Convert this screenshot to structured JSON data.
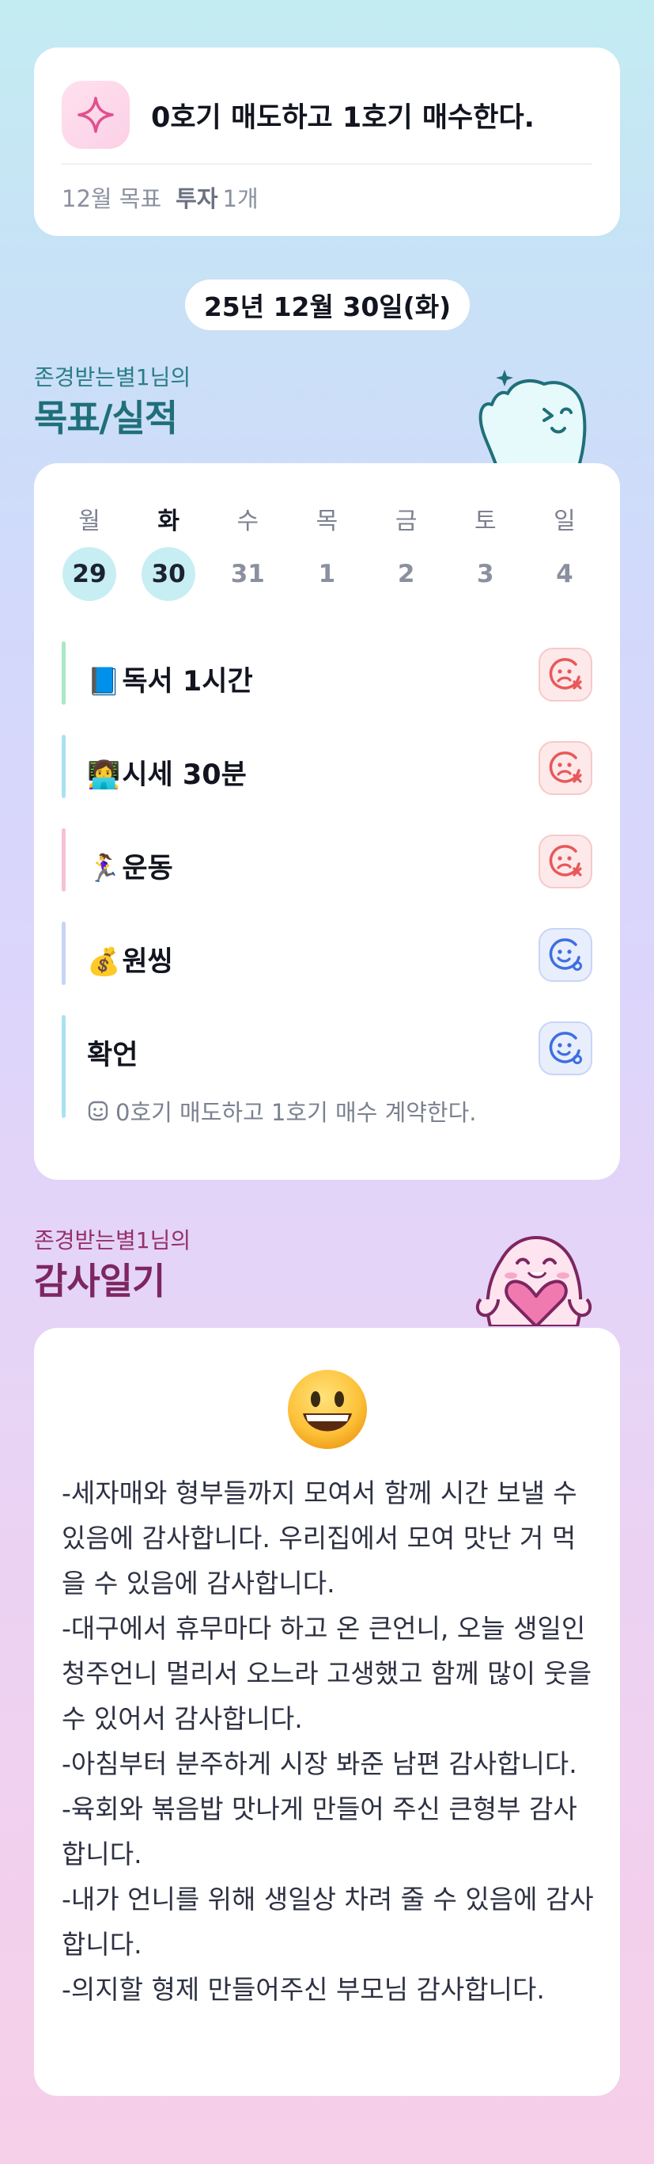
{
  "goal": {
    "title": "0호기 매도하고 1호기 매수한다.",
    "period": "12월 목표",
    "category": "투자",
    "count": "1개",
    "icon": "sparkle-icon"
  },
  "date_label": "25년 12월 30일(화)",
  "section_goals": {
    "subtitle": "존경받는별1님의",
    "title": "목표/실적"
  },
  "week": [
    {
      "dow": "월",
      "num": "29",
      "marked": true,
      "selected": false
    },
    {
      "dow": "화",
      "num": "30",
      "marked": true,
      "selected": true
    },
    {
      "dow": "수",
      "num": "31",
      "marked": false,
      "selected": false
    },
    {
      "dow": "목",
      "num": "1",
      "marked": false,
      "selected": false
    },
    {
      "dow": "금",
      "num": "2",
      "marked": false,
      "selected": false
    },
    {
      "dow": "토",
      "num": "3",
      "marked": false,
      "selected": false
    },
    {
      "dow": "일",
      "num": "4",
      "marked": false,
      "selected": false
    }
  ],
  "habits": [
    {
      "emoji": "📘",
      "label": "독서 1시간",
      "status": "bad",
      "bar_color": "#a9e8c8"
    },
    {
      "emoji": "👩‍💻",
      "label": "시세 30분",
      "status": "bad",
      "bar_color": "#a9e2ef"
    },
    {
      "emoji": "🏃‍♀️",
      "label": "운동",
      "status": "bad",
      "bar_color": "#f6c1d8"
    },
    {
      "emoji": "💰",
      "label": "원씽",
      "status": "good",
      "bar_color": "#c8d4f6"
    },
    {
      "emoji": "",
      "label": "확언",
      "status": "good",
      "bar_color": "#a9e2ef",
      "note": "0호기 매도하고 1호기 매수 계약한다."
    }
  ],
  "section_diary": {
    "subtitle": "존경받는별1님의",
    "title": "감사일기"
  },
  "diary": {
    "mood_icon": "grinning-face-icon",
    "text": "-세자매와 형부들까지 모여서 함께 시간 보낼 수 있음에 감사합니다. 우리집에서 모여 맛난 거 먹을 수 있음에 감사합니다.\n-대구에서 휴무마다 하고 온 큰언니, 오늘 생일인 청주언니 멀리서 오느라 고생했고 함께 많이 웃을 수 있어서 감사합니다.\n-아침부터 분주하게 시장 봐준 남편 감사합니다.\n-육회와 볶음밥 맛나게 만들어 주신 큰형부 감사합니다.\n-내가 언니를 위해 생일상 차려 줄 수 있음에 감사합니다.\n-의지할 형제 만들어주신 부모님 감사합니다."
  },
  "colors": {
    "bad_status": "#e8585a",
    "good_status": "#3d6fe0",
    "goals_title": "#1f6f79",
    "diary_title": "#7d2660"
  }
}
